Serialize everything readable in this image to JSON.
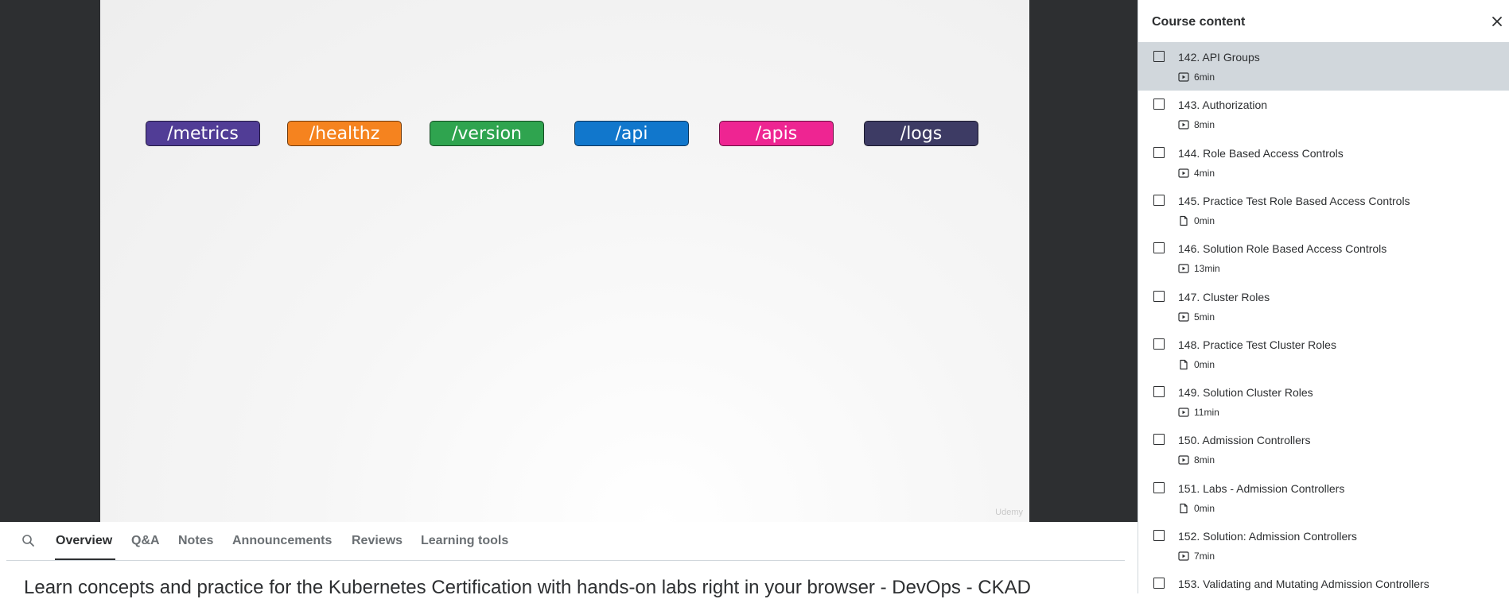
{
  "video": {
    "endpoints": [
      {
        "label": "/metrics",
        "color": "#513d96"
      },
      {
        "label": "/healthz",
        "color": "#f5831f"
      },
      {
        "label": "/version",
        "color": "#2fa44f"
      },
      {
        "label": "/api",
        "color": "#1177cc"
      },
      {
        "label": "/apis",
        "color": "#ee2592"
      },
      {
        "label": "/logs",
        "color": "#3d3b64"
      }
    ],
    "watermark": "Udemy"
  },
  "tabs": [
    {
      "label": "Overview",
      "active": true
    },
    {
      "label": "Q&A"
    },
    {
      "label": "Notes"
    },
    {
      "label": "Announcements"
    },
    {
      "label": "Reviews"
    },
    {
      "label": "Learning tools"
    }
  ],
  "course": {
    "title": "Learn concepts and practice for the Kubernetes Certification with hands-on labs right in your browser - DevOps - CKAD"
  },
  "sidebar": {
    "title": "Course content",
    "lessons": [
      {
        "title": "142. API Groups",
        "duration": "6min",
        "type": "video",
        "current": true
      },
      {
        "title": "143. Authorization",
        "duration": "8min",
        "type": "video"
      },
      {
        "title": "144. Role Based Access Controls",
        "duration": "4min",
        "type": "video"
      },
      {
        "title": "145. Practice Test Role Based Access Controls",
        "duration": "0min",
        "type": "document"
      },
      {
        "title": "146. Solution Role Based Access Controls",
        "duration": "13min",
        "type": "video"
      },
      {
        "title": "147. Cluster Roles",
        "duration": "5min",
        "type": "video"
      },
      {
        "title": "148. Practice Test Cluster Roles",
        "duration": "0min",
        "type": "document"
      },
      {
        "title": "149. Solution Cluster Roles",
        "duration": "11min",
        "type": "video"
      },
      {
        "title": "150. Admission Controllers",
        "duration": "8min",
        "type": "video"
      },
      {
        "title": "151. Labs - Admission Controllers",
        "duration": "0min",
        "type": "document"
      },
      {
        "title": "152. Solution: Admission Controllers",
        "duration": "7min",
        "type": "video"
      },
      {
        "title": "153. Validating and Mutating Admission Controllers",
        "duration": "",
        "type": "video"
      }
    ]
  }
}
